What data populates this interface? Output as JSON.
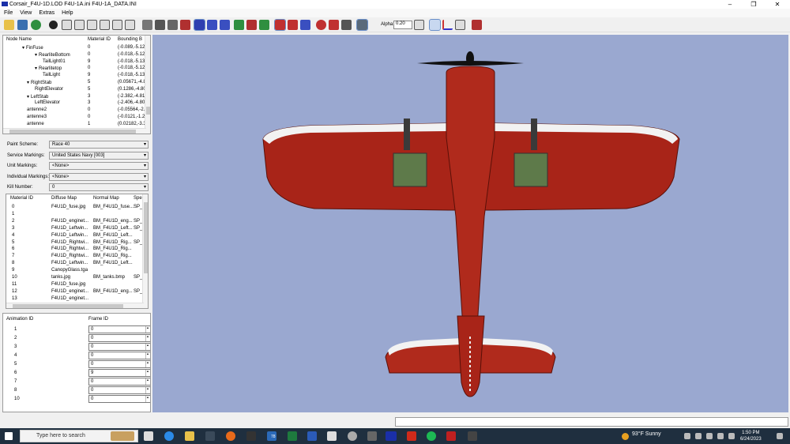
{
  "window": {
    "title": "Corsair_F4U-1D.LOD  F4U-1A.ini  F4U-1A_DATA.INI",
    "min": "–",
    "max": "❐",
    "close": "✕"
  },
  "menu": [
    "File",
    "View",
    "Extras",
    "Help"
  ],
  "toolbar": {
    "alpha_label": "Alpha:",
    "alpha_value": "0.20"
  },
  "node_tree": {
    "headers": [
      "Node Name",
      "Material ID",
      "Bounding B"
    ],
    "rows": [
      {
        "arrow": "▾",
        "name": "FinFuse",
        "mat": "0",
        "bb": "(-0.089,-5.12"
      },
      {
        "arrow": "▾",
        "name": "RearliteBottom",
        "mat": "0",
        "bb": "(-0.018,-5.12"
      },
      {
        "arrow": "",
        "name": "TailLight01",
        "mat": "9",
        "bb": "(-0.018,-5.13"
      },
      {
        "arrow": "▾",
        "name": "Rearlitetop",
        "mat": "0",
        "bb": "(-0.018,-5.12"
      },
      {
        "arrow": "",
        "name": "TailLight",
        "mat": "9",
        "bb": "(-0.018,-5.13"
      },
      {
        "arrow": "▾",
        "name": "RightStab",
        "mat": "5",
        "bb": "(0.05671,-4.8"
      },
      {
        "arrow": "",
        "name": "RightElevator",
        "mat": "5",
        "bb": "(0.1286,-4.80"
      },
      {
        "arrow": "▾",
        "name": "LeftStab",
        "mat": "3",
        "bb": "(-2.382,-4.81"
      },
      {
        "arrow": "",
        "name": "LeftElevator",
        "mat": "3",
        "bb": "(-2.406,-4.80"
      },
      {
        "arrow": "",
        "name": "antenne2",
        "mat": "0",
        "bb": "(-0.05564,-2."
      },
      {
        "arrow": "",
        "name": "antenne3",
        "mat": "0",
        "bb": "(-0.0121,-1.2"
      },
      {
        "arrow": "",
        "name": "antenne",
        "mat": "1",
        "bb": "(0.02182,-3.3"
      }
    ]
  },
  "scheme": {
    "fields": [
      {
        "label": "Paint Scheme:",
        "value": "Race 40"
      },
      {
        "label": "Service Markings:",
        "value": "United States Navy [003]"
      },
      {
        "label": "Unit Markings:",
        "value": "<None>"
      },
      {
        "label": "Individual Markings:",
        "value": "<None>"
      },
      {
        "label": "Kill Number:",
        "value": "0"
      }
    ]
  },
  "materials": {
    "headers": [
      "Material ID",
      "Diffuse Map",
      "Normal Map",
      "Spe"
    ],
    "rows": [
      {
        "id": "0",
        "diffuse": "F4U1D_fuse.jpg",
        "normal": "BM_F4U1D_fuse...",
        "spec": "SP_"
      },
      {
        "id": "1",
        "diffuse": "",
        "normal": "",
        "spec": ""
      },
      {
        "id": "2",
        "diffuse": "F4U1D_enginet...",
        "normal": "BM_F4U1D_eng...",
        "spec": "SP_"
      },
      {
        "id": "3",
        "diffuse": "F4U1D_Leftwin...",
        "normal": "BM_F4U1D_Left...",
        "spec": "SP_"
      },
      {
        "id": "4",
        "diffuse": "F4U1D_Leftwin...",
        "normal": "BM_F4U1D_Left...",
        "spec": ""
      },
      {
        "id": "5",
        "diffuse": "F4U1D_Rightwi...",
        "normal": "BM_F4U1D_Rig...",
        "spec": "SP_"
      },
      {
        "id": "6",
        "diffuse": "F4U1D_Rightwi...",
        "normal": "BM_F4U1D_Rig...",
        "spec": ""
      },
      {
        "id": "7",
        "diffuse": "F4U1D_Rightwi...",
        "normal": "BM_F4U1D_Rig...",
        "spec": ""
      },
      {
        "id": "8",
        "diffuse": "F4U1D_Leftwin...",
        "normal": "BM_F4U1D_Left...",
        "spec": ""
      },
      {
        "id": "9",
        "diffuse": "CanopyGlass.tga",
        "normal": "",
        "spec": ""
      },
      {
        "id": "10",
        "diffuse": "tanks.jpg",
        "normal": "BM_tanks.bmp",
        "spec": "SP_"
      },
      {
        "id": "11",
        "diffuse": "F4U1D_fuse.jpg",
        "normal": "",
        "spec": ""
      },
      {
        "id": "12",
        "diffuse": "F4U1D_enginet...",
        "normal": "BM_F4U1D_eng...",
        "spec": "SP_"
      },
      {
        "id": "13",
        "diffuse": "F4U1D_enginet...",
        "normal": "",
        "spec": ""
      }
    ]
  },
  "animation": {
    "headers": [
      "Animation ID",
      "Frame ID"
    ],
    "rows": [
      {
        "id": "1",
        "frame": "0"
      },
      {
        "id": "2",
        "frame": "0"
      },
      {
        "id": "3",
        "frame": "0"
      },
      {
        "id": "4",
        "frame": "0"
      },
      {
        "id": "5",
        "frame": "0"
      },
      {
        "id": "6",
        "frame": "9"
      },
      {
        "id": "7",
        "frame": "0"
      },
      {
        "id": "8",
        "frame": "0"
      },
      {
        "id": "10",
        "frame": "0"
      }
    ]
  },
  "taskbar": {
    "search_placeholder": "Type here to search",
    "weather": "93°F  Sunny",
    "time": "1:50 PM",
    "date": "6/24/2023",
    "mail_badge": "78"
  }
}
